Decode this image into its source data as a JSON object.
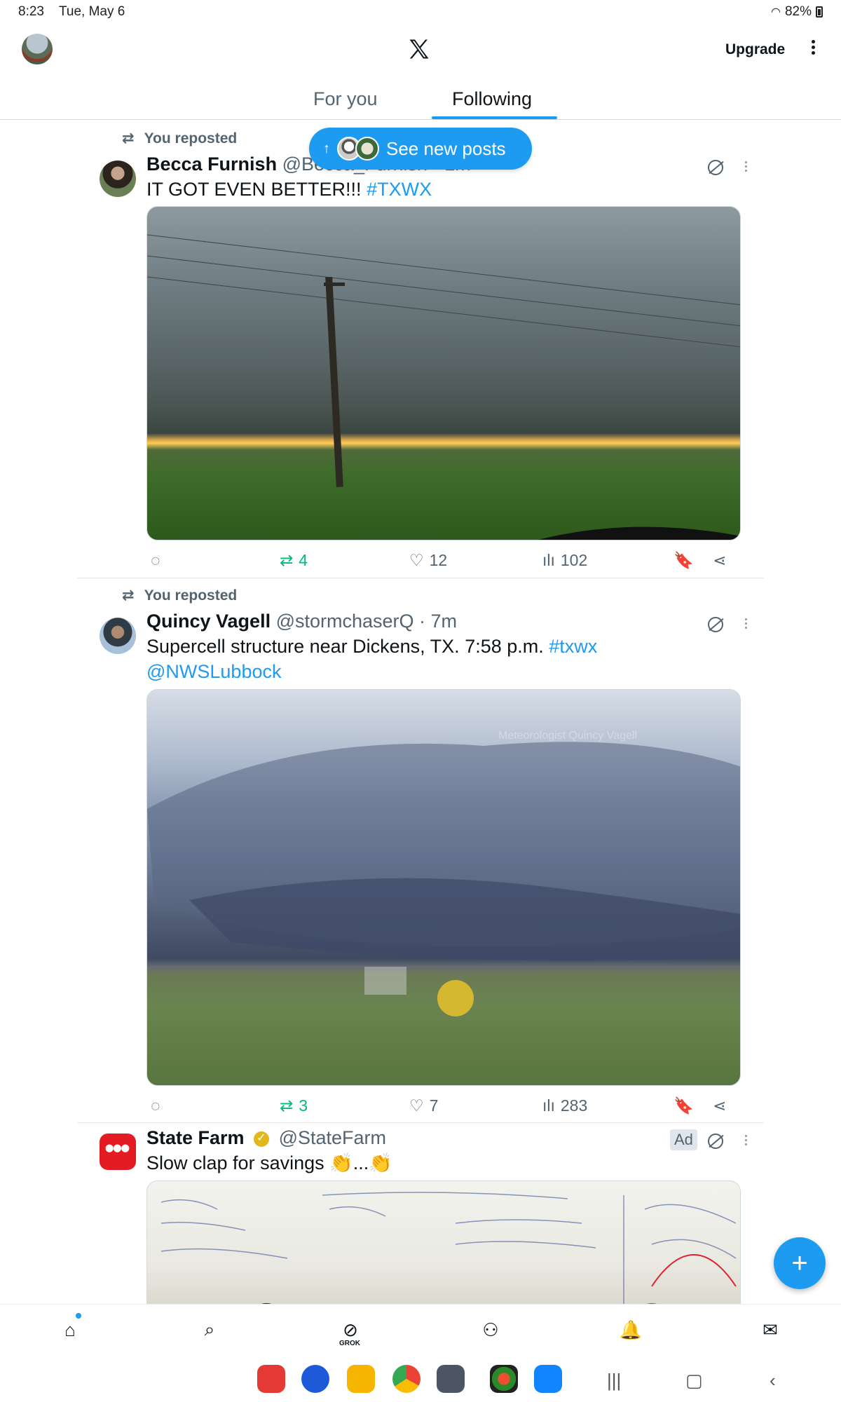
{
  "status_bar": {
    "time": "8:23",
    "date": "Tue, May 6",
    "battery": "82%"
  },
  "app_bar": {
    "upgrade_label": "Upgrade"
  },
  "tabs": [
    {
      "label": "For you"
    },
    {
      "label": "Following"
    }
  ],
  "new_posts_pill": {
    "label": "See new posts"
  },
  "tweets": [
    {
      "repost_label": "You reposted",
      "name": "Becca Furnish",
      "handle": "@Becca_Furnish · 1m",
      "text": "IT GOT EVEN BETTER!!!",
      "hashtag": "#TXWX",
      "actions": {
        "reposts": "4",
        "likes": "12",
        "views": "102"
      }
    },
    {
      "repost_label": "You reposted",
      "name": "Quincy Vagell",
      "handle": "@stormchaserQ · 7m",
      "text": "Supercell structure near Dickens, TX. 7:58 p.m.",
      "hashtag": "#txwx",
      "mention": "@NWSLubbock",
      "watermark": "Meteorologist Quincy Vagell",
      "actions": {
        "reposts": "3",
        "likes": "7",
        "views": "283"
      }
    },
    {
      "name": "State Farm",
      "handle": "@StateFarm",
      "text": "Slow clap for savings 👏...👏",
      "ad_label": "Ad"
    }
  ],
  "icons": {
    "reply": "reply-icon",
    "repost": "repost-icon",
    "like": "heart-icon",
    "views": "views-icon",
    "bookmark": "bookmark-icon",
    "share": "share-icon",
    "grok": "grok-icon",
    "more": "more-icon"
  },
  "bottom_nav": {
    "grok_label": "GROK"
  },
  "colors": {
    "accent": "#1d9bf0",
    "repost_green": "#00ba7c",
    "text": "#0f1419",
    "muted": "#536471"
  }
}
